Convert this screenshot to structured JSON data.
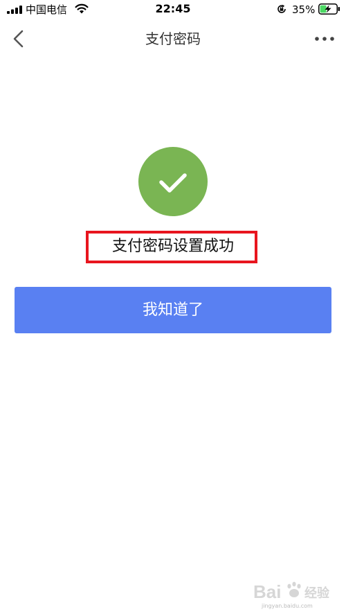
{
  "status_bar": {
    "carrier": "中国电信",
    "time": "22:45",
    "battery_percent": "35%",
    "signal_icon": "signal-bars-icon",
    "wifi_icon": "wifi-icon",
    "rotation_icon": "rotation-lock-icon",
    "battery_icon": "battery-charging-icon",
    "battery_color": "#4cd964"
  },
  "nav": {
    "title": "支付密码",
    "back_icon": "chevron-left-icon",
    "more_icon": "more-dots-icon"
  },
  "result": {
    "icon": "checkmark-icon",
    "icon_color": "#7ab553",
    "message": "支付密码设置成功",
    "highlight_color": "#e8151e"
  },
  "actions": {
    "confirm_label": "我知道了",
    "confirm_color": "#5980f2"
  },
  "watermark": {
    "logo_text": "Bai 经验",
    "domain": "jingyan.baidu.com"
  }
}
